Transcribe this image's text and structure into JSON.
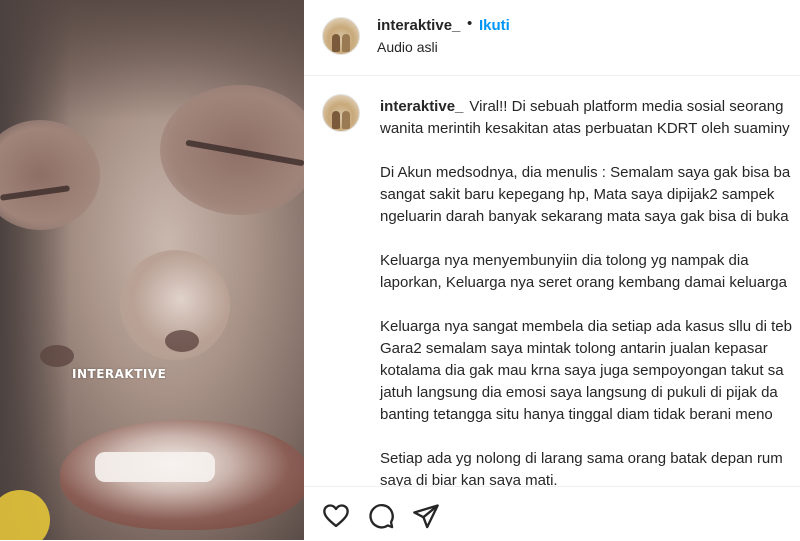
{
  "media": {
    "watermark": "INTERAKTIVE"
  },
  "header": {
    "username": "interaktive_",
    "separator": "•",
    "follow_label": "Ikuti",
    "audio_label": "Audio asli"
  },
  "caption": {
    "username": "interaktive_",
    "paragraphs": [
      [
        "Viral!! Di sebuah platform media sosial seorang",
        "wanita merintih kesakitan atas perbuatan KDRT oleh suaminy"
      ],
      [
        "Di Akun medsodnya, dia menulis : Semalam saya gak bisa ba",
        "sangat sakit baru kepegang hp, Mata saya dipijak2 sampek",
        "ngeluarin darah banyak sekarang mata saya gak bisa di buka"
      ],
      [
        "Keluarga nya menyembunyiin dia tolong yg nampak dia",
        "laporkan, Keluarga nya seret orang kembang damai keluarga"
      ],
      [
        "Keluarga nya sangat membela dia setiap ada kasus sllu di teb",
        "Gara2 semalam saya mintak tolong antarin jualan kepasar",
        "kotalama dia gak mau krna saya juga sempoyongan takut sa",
        "jatuh langsung dia emosi saya langsung di pukuli di pijak da",
        "banting tetangga situ hanya tinggal diam tidak berani meno"
      ],
      [
        "Setiap ada yg nolong di larang sama orang batak depan rum",
        "saya di biar kan saya mati."
      ]
    ]
  },
  "actions": {
    "icons": [
      "heart-icon",
      "comment-icon",
      "share-icon"
    ]
  },
  "colors": {
    "accent": "#0095f6",
    "text": "#262626",
    "divider": "#efefef"
  }
}
